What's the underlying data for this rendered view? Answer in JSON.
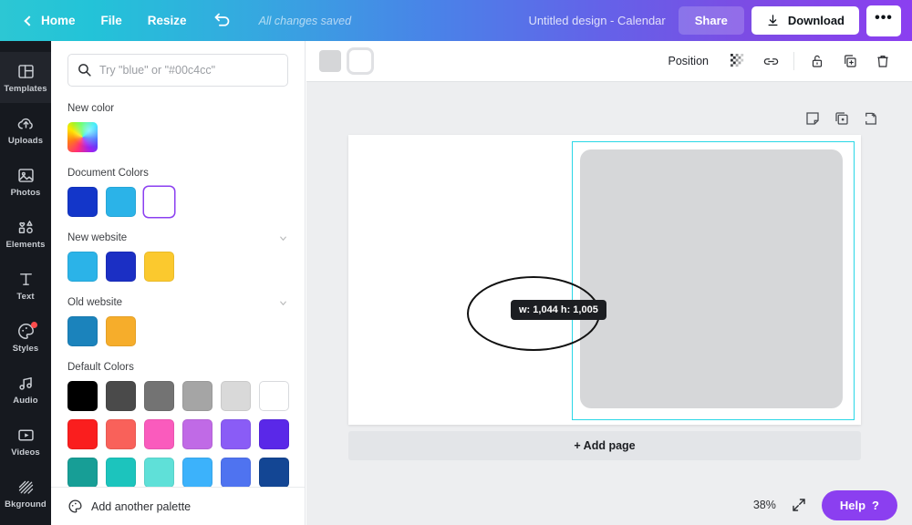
{
  "topbar": {
    "back_icon": "chevron-left-icon",
    "home_label": "Home",
    "file_label": "File",
    "resize_label": "Resize",
    "undo_icon": "undo-arrow-icon",
    "saved_status": "All changes saved",
    "design_title": "Untitled design - Calendar",
    "share_label": "Share",
    "download_label": "Download",
    "download_icon": "download-arrow-icon",
    "more_label": "•••",
    "gradient_start": "#2cc7d4",
    "gradient_end": "#8b3ff0"
  },
  "rail": {
    "items": [
      {
        "label": "Templates",
        "icon": "templates-icon",
        "active": true,
        "badge": false
      },
      {
        "label": "Uploads",
        "icon": "upload-cloud-icon",
        "active": false,
        "badge": false
      },
      {
        "label": "Photos",
        "icon": "photo-icon",
        "active": false,
        "badge": false
      },
      {
        "label": "Elements",
        "icon": "elements-shapes-icon",
        "active": false,
        "badge": false
      },
      {
        "label": "Text",
        "icon": "text-t-icon",
        "active": false,
        "badge": false
      },
      {
        "label": "Styles",
        "icon": "palette-icon",
        "active": false,
        "badge": true
      },
      {
        "label": "Audio",
        "icon": "music-note-icon",
        "active": false,
        "badge": false
      },
      {
        "label": "Videos",
        "icon": "video-play-icon",
        "active": false,
        "badge": false
      },
      {
        "label": "Bkground",
        "icon": "hatch-pattern-icon",
        "active": false,
        "badge": false
      }
    ]
  },
  "panel": {
    "search": {
      "placeholder": "Try \"blue\" or \"#00c4cc\"",
      "value": "",
      "icon": "search-icon"
    },
    "sections": [
      {
        "title": "New color",
        "type": "picker",
        "collapsible": false
      },
      {
        "title": "Document Colors",
        "type": "swatches",
        "collapsible": false,
        "colors": [
          "#1336c9",
          "#2bb3e8",
          "#ffffff"
        ],
        "selected_index": 2
      },
      {
        "title": "New website",
        "type": "swatches",
        "collapsible": true,
        "colors": [
          "#2bb3e8",
          "#1b2fc4",
          "#fbc92e"
        ]
      },
      {
        "title": "Old website",
        "type": "swatches",
        "collapsible": true,
        "colors": [
          "#1b83bc",
          "#f6ad2b"
        ]
      },
      {
        "title": "Default Colors",
        "type": "grid",
        "collapsible": false,
        "colors": [
          "#000000",
          "#4a4a4a",
          "#737373",
          "#a5a5a5",
          "#d9d9d9",
          "#ffffff",
          "#fa1e1e",
          "#f9615a",
          "#fa5bbd",
          "#c06ae6",
          "#8a5cf6",
          "#5a28e8",
          "#179e96",
          "#1cc4bd",
          "#5fe0d8",
          "#3cb2fb",
          "#4f73f0",
          "#134694"
        ]
      }
    ],
    "footer": {
      "label": "Add another palette",
      "icon": "palette-icon"
    }
  },
  "editor": {
    "toolbar": {
      "swatch_a_color": "#d5d6d8",
      "swatch_b_color": "#ffffff",
      "position_label": "Position",
      "transparency_icon": "transparency-checker-icon",
      "link_icon": "link-icon",
      "lock_icon": "lock-icon",
      "duplicate_icon": "duplicate-icon",
      "delete_icon": "trash-icon"
    },
    "page_tools": [
      {
        "icon": "note-icon"
      },
      {
        "icon": "copy-page-icon"
      },
      {
        "icon": "add-page-icon"
      }
    ],
    "canvas": {
      "selection_color": "#29d7e6",
      "shape_color": "#d6d7d9",
      "size_tooltip": "w: 1,044 h: 1,005",
      "ellipse_icon": "ellipse-shape"
    },
    "add_page_label": "+ Add page",
    "zoom_level": "38%",
    "expand_icon": "expand-arrows-icon",
    "help_label": "Help",
    "help_icon": "question-mark-icon",
    "help_color": "#8b3ff0"
  }
}
